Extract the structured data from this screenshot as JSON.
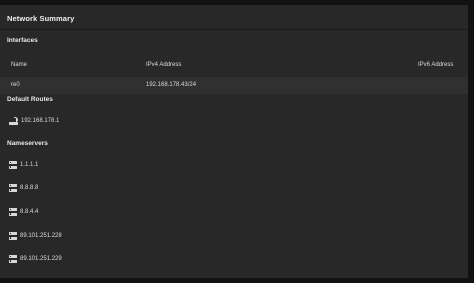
{
  "card": {
    "title": "Network Summary"
  },
  "interfaces": {
    "label": "Interfaces",
    "columns": [
      "Name",
      "IPv4 Address",
      "IPv6 Address"
    ],
    "rows": [
      [
        "re0",
        "192.168.178.43/24",
        ""
      ]
    ]
  },
  "default_routes": {
    "label": "Default Routes",
    "items": [
      "192.168.178.1"
    ],
    "icon": "router-icon"
  },
  "nameservers": {
    "label": "Nameservers",
    "items": [
      "1.1.1.1",
      "8.8.8.8",
      "8.8.4.4",
      "89.101.251.228",
      "89.101.251.229"
    ],
    "icon": "server-icon"
  },
  "colors": {
    "page_bg": "#121212",
    "card_bg": "#282828",
    "row_bg": "#303030",
    "text": "#dcdcdc"
  }
}
